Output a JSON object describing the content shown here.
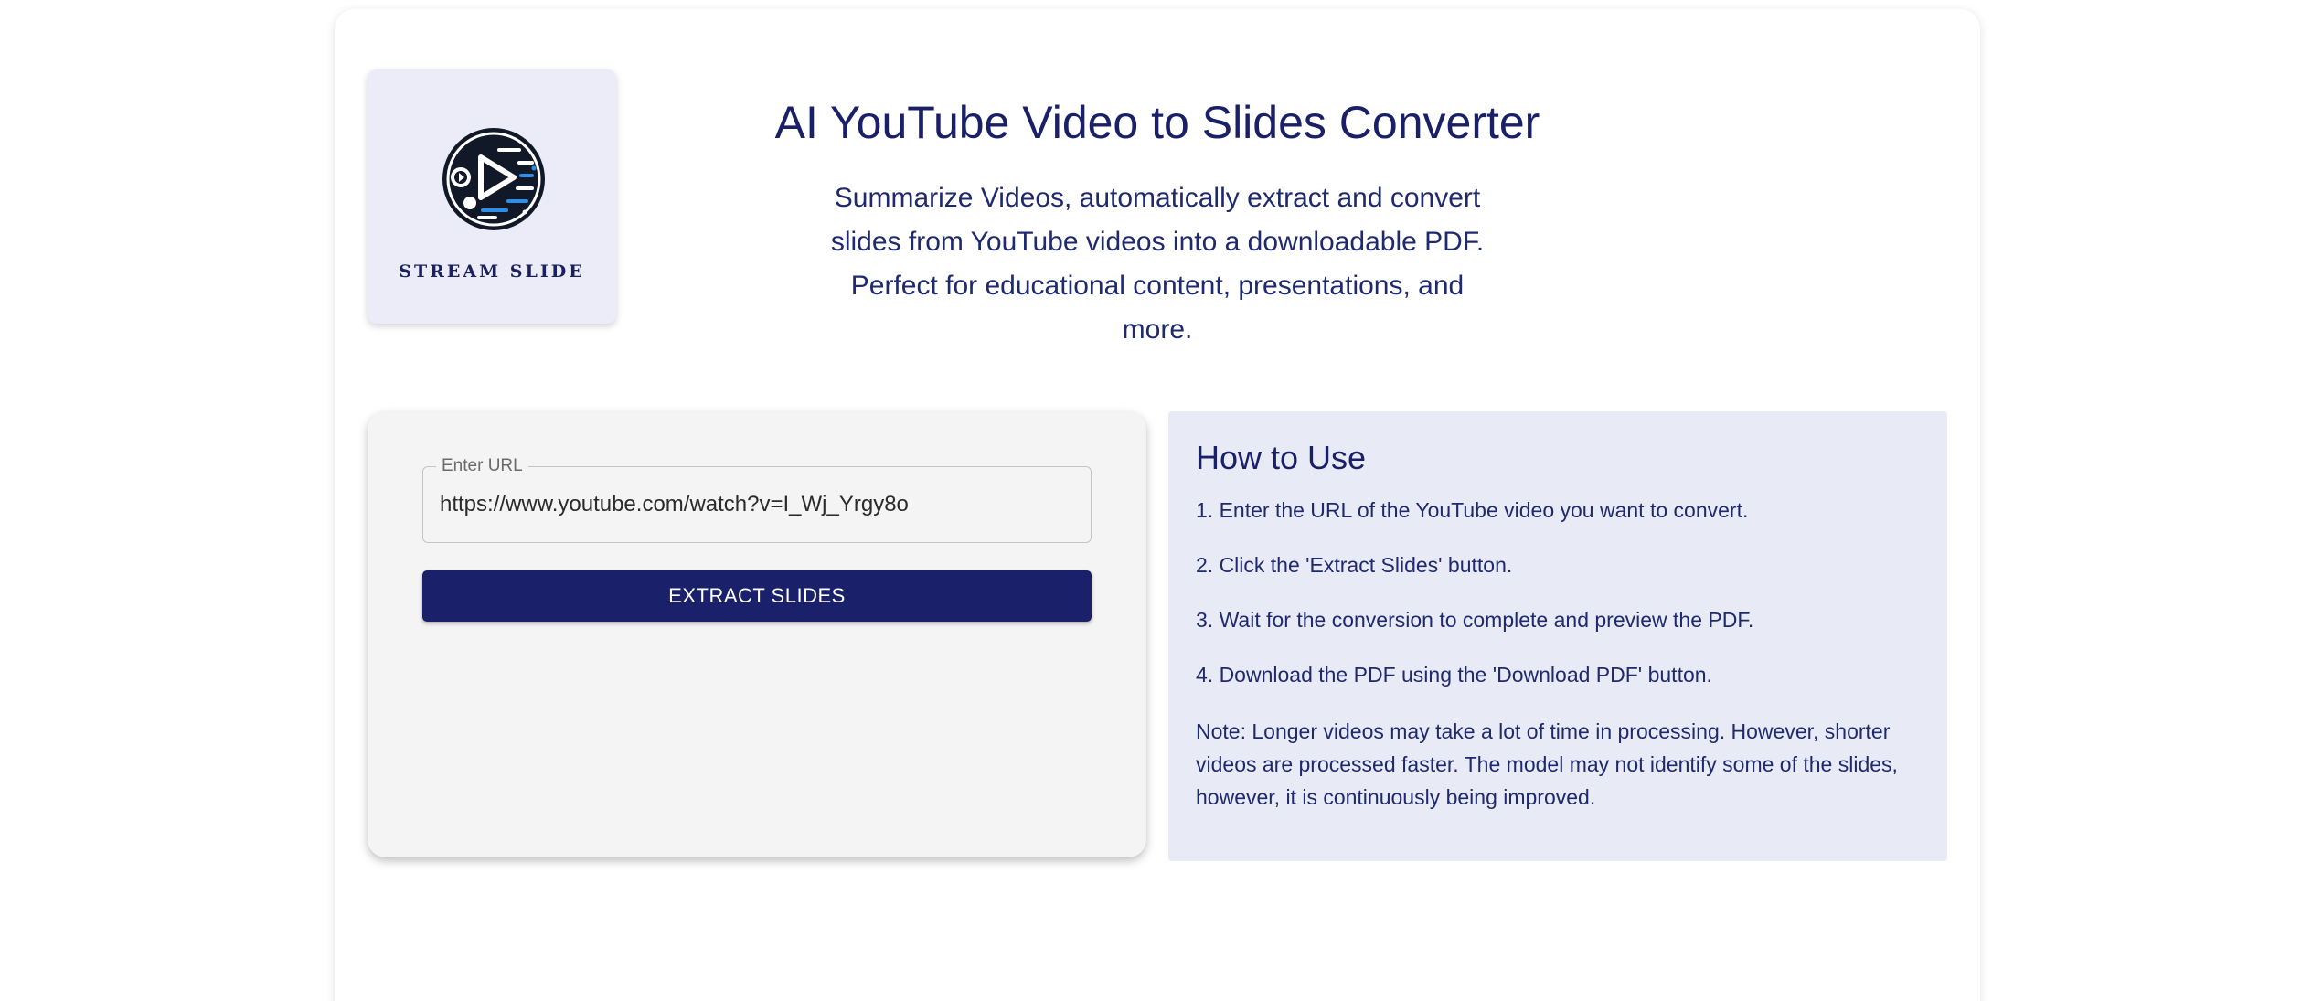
{
  "logo": {
    "text": "STREAM SLIDE",
    "icon": "play-stream-icon",
    "colors": {
      "dark": "#111827",
      "accent": "#2f8fe8"
    }
  },
  "header": {
    "title": "AI YouTube Video to Slides Converter",
    "subtitle": "Summarize Videos, automatically extract and convert slides from YouTube videos into a downloadable PDF. Perfect for educational content, presentations, and more."
  },
  "form": {
    "url_label": "Enter URL",
    "url_value": "https://www.youtube.com/watch?v=I_Wj_Yrgy8o",
    "button_label": "EXTRACT SLIDES"
  },
  "howto": {
    "title": "How to Use",
    "steps": [
      "1. Enter the URL of the YouTube video you want to convert.",
      "2. Click the 'Extract Slides' button.",
      "3. Wait for the conversion to complete and preview the PDF.",
      "4. Download the PDF using the 'Download PDF' button."
    ],
    "note": "Note: Longer videos may take a lot of time in processing. However, shorter videos are processed faster. The model may not identify some of the slides, however, it is continuously being improved."
  },
  "colors": {
    "primary": "#1a206a",
    "howto_bg": "#e8eaf6",
    "form_bg": "#f4f4f4",
    "logo_bg": "#ececf8"
  }
}
